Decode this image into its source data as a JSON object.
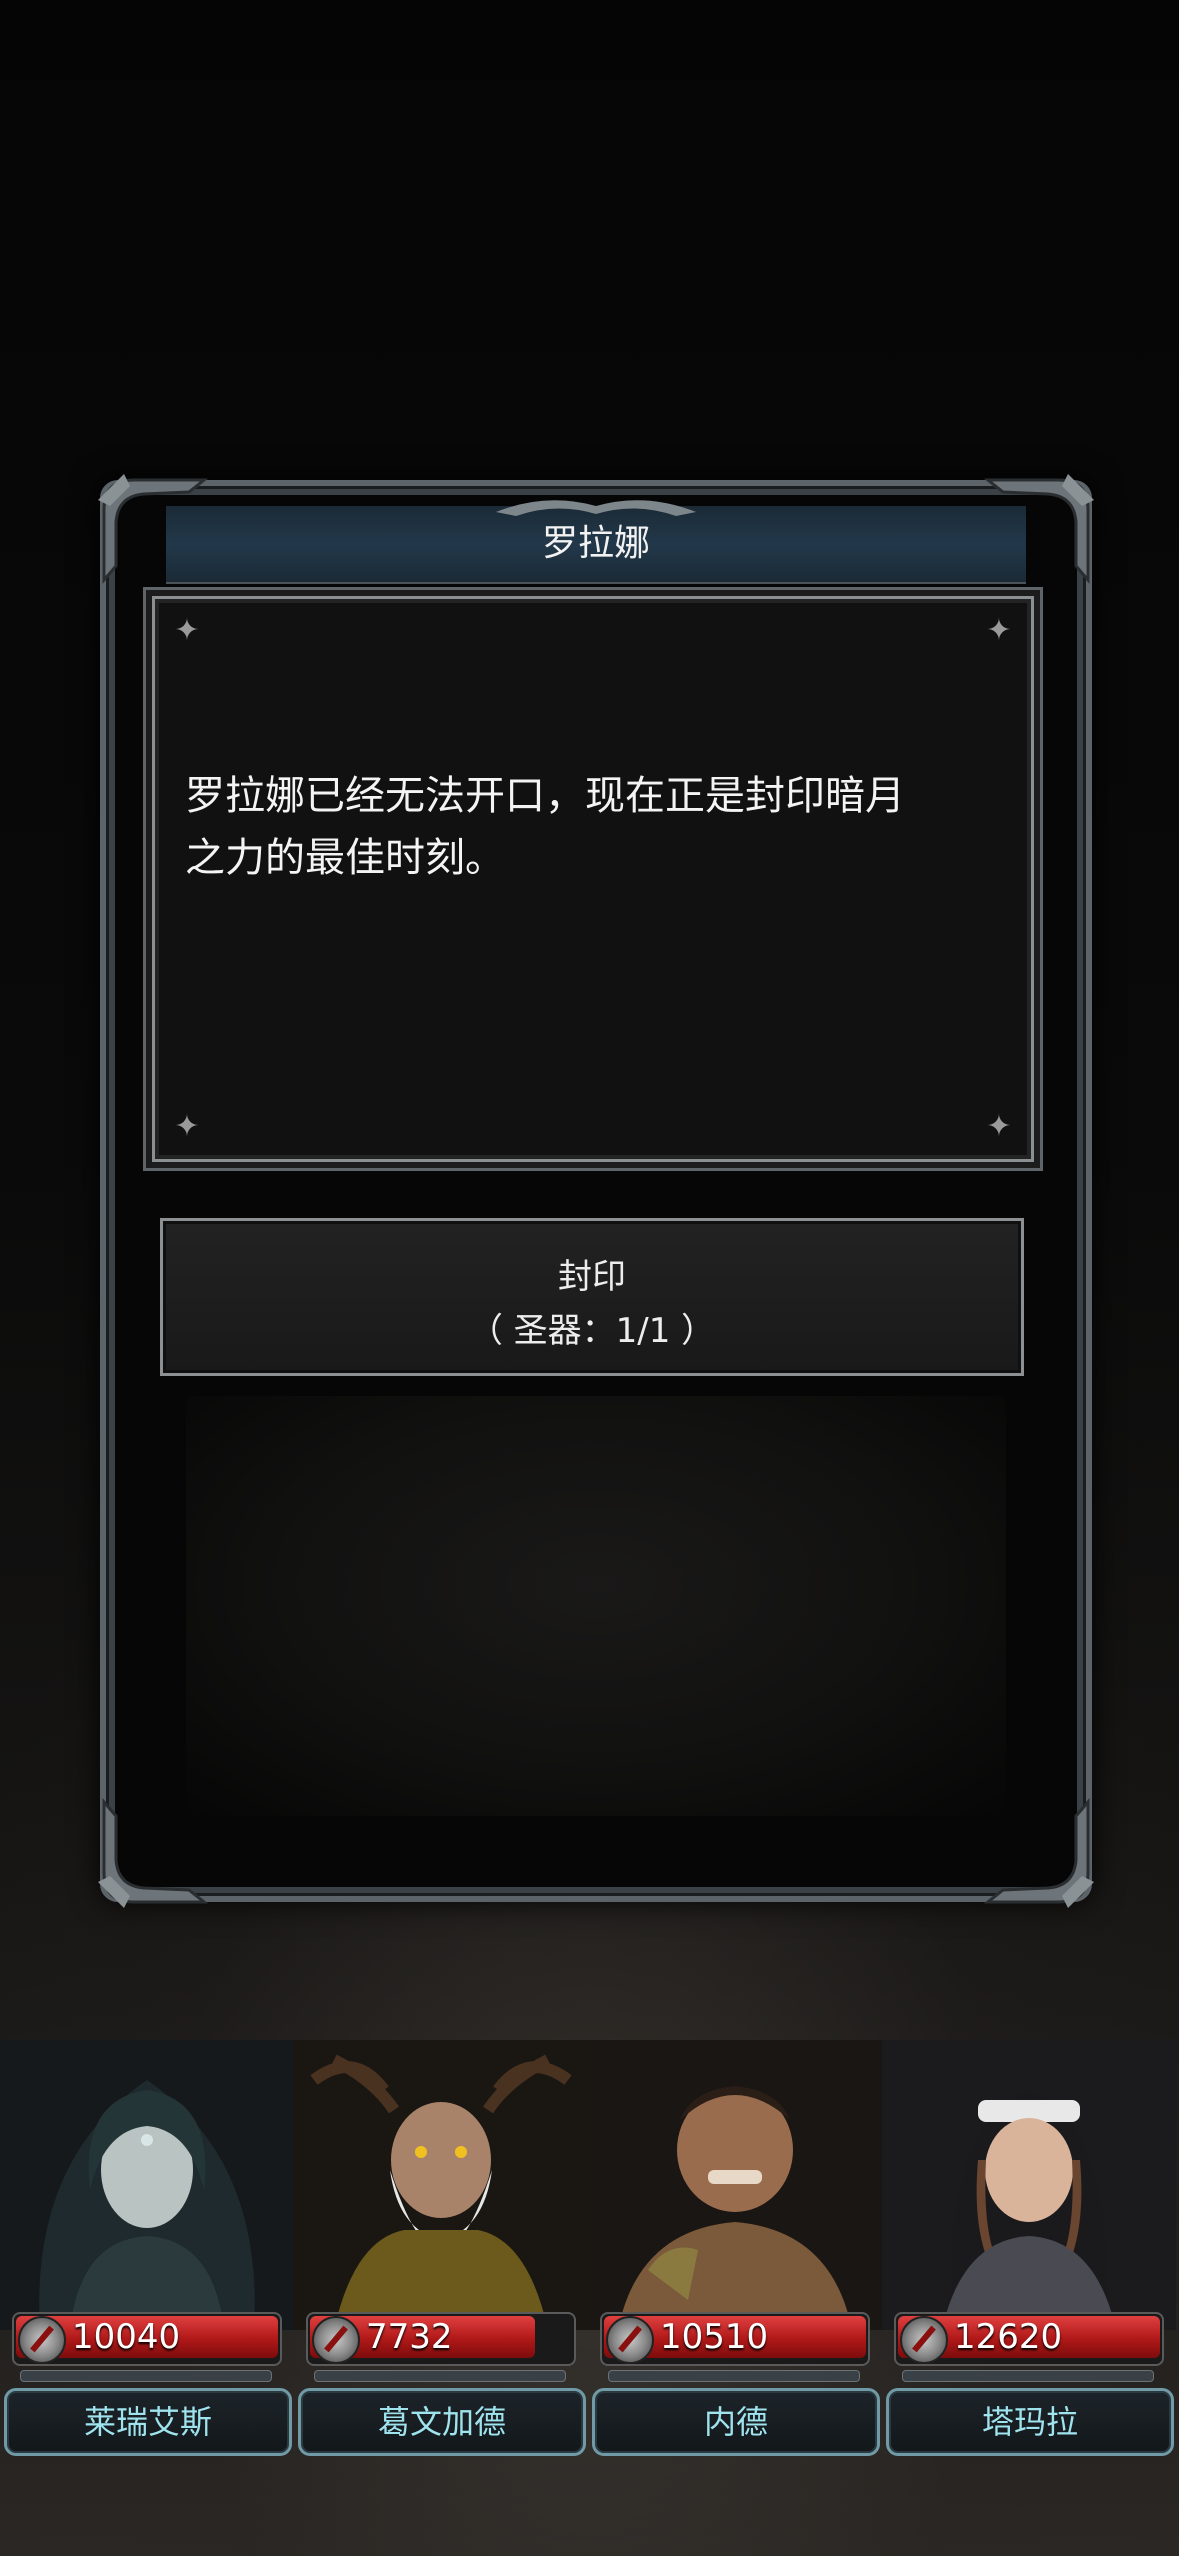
{
  "dialog": {
    "title": "罗拉娜",
    "body_lines": [
      "罗拉娜已经无法开口，现在正是封印暗月",
      "之力的最佳时刻。"
    ],
    "action": {
      "label": "封印",
      "requirement": "（ 圣器：1/1 ）"
    }
  },
  "party": [
    {
      "name": "莱瑞艾斯",
      "hp": "10040",
      "hp_fill": 1.0,
      "accent": "#2f6d6a"
    },
    {
      "name": "葛文加德",
      "hp": "7732",
      "hp_fill": 0.86,
      "accent": "#6b5a1c"
    },
    {
      "name": "内德",
      "hp": "10510",
      "hp_fill": 1.0,
      "accent": "#7a5a3a"
    },
    {
      "name": "塔玛拉",
      "hp": "12620",
      "hp_fill": 1.0,
      "accent": "#4a4a52"
    }
  ],
  "colors": {
    "hp_red": "#c62020",
    "name_text": "#9fe3ee",
    "frame": "#5c646a"
  }
}
